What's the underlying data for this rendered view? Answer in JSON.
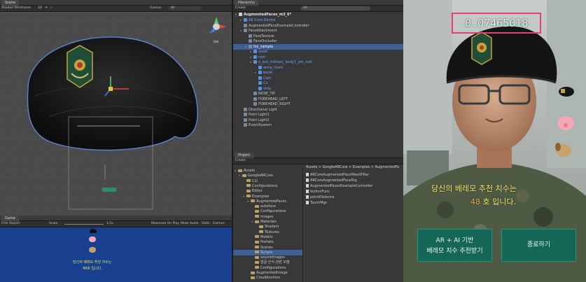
{
  "scene": {
    "tab": "Scene",
    "shading": "Shaded Wireframe",
    "mode_2d": "2D",
    "gizmos": "Gizmos",
    "search": "All",
    "persp": "Iso"
  },
  "game": {
    "tab": "Game",
    "aspect": "Free Aspect",
    "scale_label": "Scale",
    "scale_value": "1.5x",
    "maximize": "Maximize On Play",
    "mute": "Mute Audio",
    "stats": "Stats",
    "gizmos": "Gizmos"
  },
  "hierarchy": {
    "tab": "Hierarchy",
    "create": "Create",
    "search": "All",
    "scene_name": "AugmentedFaces_m3_6*",
    "items": [
      {
        "label": "AR Core Device",
        "indent": 1,
        "arrow": "▸",
        "blue": true
      },
      {
        "label": "AugmentedFaceExampleController",
        "indent": 1
      },
      {
        "label": "FaceAttachment",
        "indent": 1,
        "arrow": "▾"
      },
      {
        "label": "FaceTexture",
        "indent": 2
      },
      {
        "label": "FaceOccluder",
        "indent": 2
      },
      {
        "label": "fzx_sample",
        "indent": 2,
        "arrow": "▾",
        "selected": true
      },
      {
        "label": "asset",
        "indent": 3,
        "arrow": "▸",
        "blue": true
      },
      {
        "label": "root",
        "indent": 3,
        "arrow": "▸",
        "blue": true
      },
      {
        "label": "x_sub_military_body1_am_root",
        "indent": 3,
        "arrow": "▾",
        "blue": true
      },
      {
        "label": "army_mark",
        "indent": 4,
        "blue": true
      },
      {
        "label": "beret",
        "indent": 4,
        "arrow": "▸",
        "blue": true
      },
      {
        "label": "Cam",
        "indent": 4,
        "blue": true
      },
      {
        "label": "Cx",
        "indent": 4,
        "blue": true
      },
      {
        "label": "strip",
        "indent": 4,
        "blue": true
      },
      {
        "label": "NOSE_TIP",
        "indent": 3
      },
      {
        "label": "FOREHEAD_LEFT",
        "indent": 3
      },
      {
        "label": "FOREHEAD_RIGHT",
        "indent": 3
      },
      {
        "label": "Directional Light",
        "indent": 1
      },
      {
        "label": "Point Light1",
        "indent": 1
      },
      {
        "label": "Point Light2",
        "indent": 1
      },
      {
        "label": "EventSystem",
        "indent": 1
      }
    ]
  },
  "project": {
    "tab": "Project",
    "create": "Create",
    "breadcrumb": "Assets > GoogleARCore > Examples > AugmentedFa",
    "tree": [
      {
        "label": "Assets",
        "indent": 0,
        "arrow": "▾"
      },
      {
        "label": "GoogleARCore",
        "indent": 1,
        "arrow": "▾"
      },
      {
        "label": "CLI",
        "indent": 2
      },
      {
        "label": "Configurations",
        "indent": 2
      },
      {
        "label": "Editor",
        "indent": 2
      },
      {
        "label": "Examples",
        "indent": 2,
        "arrow": "▾"
      },
      {
        "label": "AugmentedFaces",
        "indent": 3,
        "arrow": "▾"
      },
      {
        "label": "autoface",
        "indent": 4
      },
      {
        "label": "Configurations",
        "indent": 4
      },
      {
        "label": "images",
        "indent": 4
      },
      {
        "label": "Materials",
        "indent": 4,
        "arrow": "▾"
      },
      {
        "label": "Shaders",
        "indent": 5
      },
      {
        "label": "Textures",
        "indent": 5
      },
      {
        "label": "Models",
        "indent": 4
      },
      {
        "label": "Prefabs",
        "indent": 4
      },
      {
        "label": "Scenes",
        "indent": 4
      },
      {
        "label": "Scripts",
        "indent": 4,
        "selected": true
      },
      {
        "label": "sourceimages",
        "indent": 4
      },
      {
        "label": "얼굴 인식 관련 모델",
        "indent": 4
      },
      {
        "label": "Configurations",
        "indent": 4
      },
      {
        "label": "AugmentedImage",
        "indent": 3
      },
      {
        "label": "CloudAnchors",
        "indent": 3
      }
    ],
    "files": [
      "ARCoreAugmentedFaceMeshFilter",
      "ARCoreAugmentedFaceRig",
      "AugmentedFacesExampleController",
      "buttonFunc",
      "pointDistance",
      "TouchMgr"
    ]
  },
  "game_overlay": {
    "line1": "당신의 베레모 추천 치수는",
    "line2": "48호 입니다."
  },
  "phone": {
    "value_readout": "0.07465018",
    "recommend_line": "당신의 베레모 추천 치수는",
    "size_number": "48",
    "size_suffix": "호 입니다.",
    "left_button_line1": "AR + AI 기반",
    "left_button_line2": "베레모 치수 추천받기",
    "right_button": "종료하기"
  },
  "colors": {
    "accent_box": "#e0417a",
    "value_text": "#d7f5f0",
    "size_number": "#f0a34a",
    "button_bg": "#146656"
  }
}
